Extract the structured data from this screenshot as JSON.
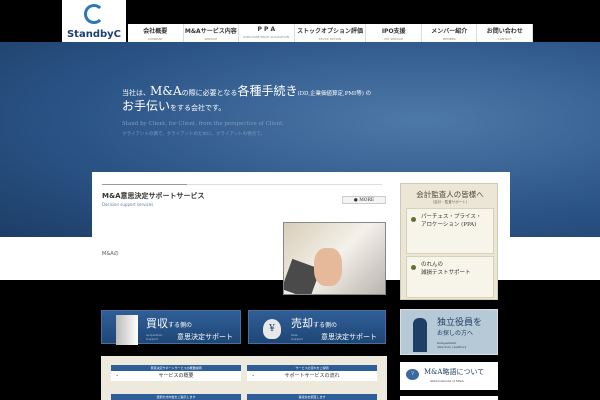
{
  "logo": {
    "name": "StandbyC"
  },
  "nav": [
    {
      "jp": "会社概要",
      "en": "COMPANY"
    },
    {
      "jp": "M&Aサービス内容",
      "en": "SERVICE"
    },
    {
      "jp": "P P A",
      "en": "PURCHASE PRICE ALLOCATION"
    },
    {
      "jp": "ストックオプション評価",
      "en": "STOCK OPTION"
    },
    {
      "jp": "IPO支援",
      "en": "IPO SERVICE"
    },
    {
      "jp": "メンバー紹介",
      "en": "MEMBER"
    },
    {
      "jp": "お問い合わせ",
      "en": "CONTACT"
    }
  ],
  "hero": {
    "a": "当社は、",
    "b": "M&A",
    "c": "の際に必要となる",
    "d": "各種手続き",
    "e": "(DD,企業価値算定,PMI等) の",
    "f": "お手伝い",
    "g": "をする会社です。",
    "en": "Stand by Client, for Client, from the perspective of Client.",
    "jp2": "クライアントの側で、クライアントのために、クライアントの視点で。"
  },
  "panel": {
    "title": "M&A意思決定サポートサービス",
    "subtitle": "Decision support services",
    "more": "MORE",
    "text": "M&Aの"
  },
  "side": {
    "title": "会計監査人の皆様へ",
    "sub": "(会計・監査サポート)",
    "ppa1": "パーチェス・プライス・",
    "ppa2": "アロケーション (PPA)",
    "nr1": "のれんの",
    "nr2": "減損テストサポート"
  },
  "buy": {
    "big": "買収",
    "small": "する側の",
    "en1": "Acquisition",
    "en2": "Support",
    "rest": "意思決定サポート"
  },
  "sell": {
    "big": "売却",
    "small": "する側の",
    "en1": "Sale",
    "en2": "Support",
    "rest": "意思決定サポート",
    "icon": "¥"
  },
  "ind": {
    "j1": "独立役員を",
    "j2": "お探しの方へ",
    "e1": "Independent",
    "e2": "directors / auditors"
  },
  "gloss": {
    "icon": "?",
    "j": "M&A略語について",
    "e": "Abbreviations of M&A"
  },
  "services": [
    {
      "hd": "意思決定サポートサービスの概要説明",
      "bd": "サービスの概要"
    },
    {
      "hd": "サービスの流れをご説明",
      "bd": "サポートサービスの流れ"
    },
    {
      "hd": "選択の方向性をご提示します",
      "bd": ""
    },
    {
      "hd": "買収先を調査します",
      "bd": ""
    }
  ]
}
